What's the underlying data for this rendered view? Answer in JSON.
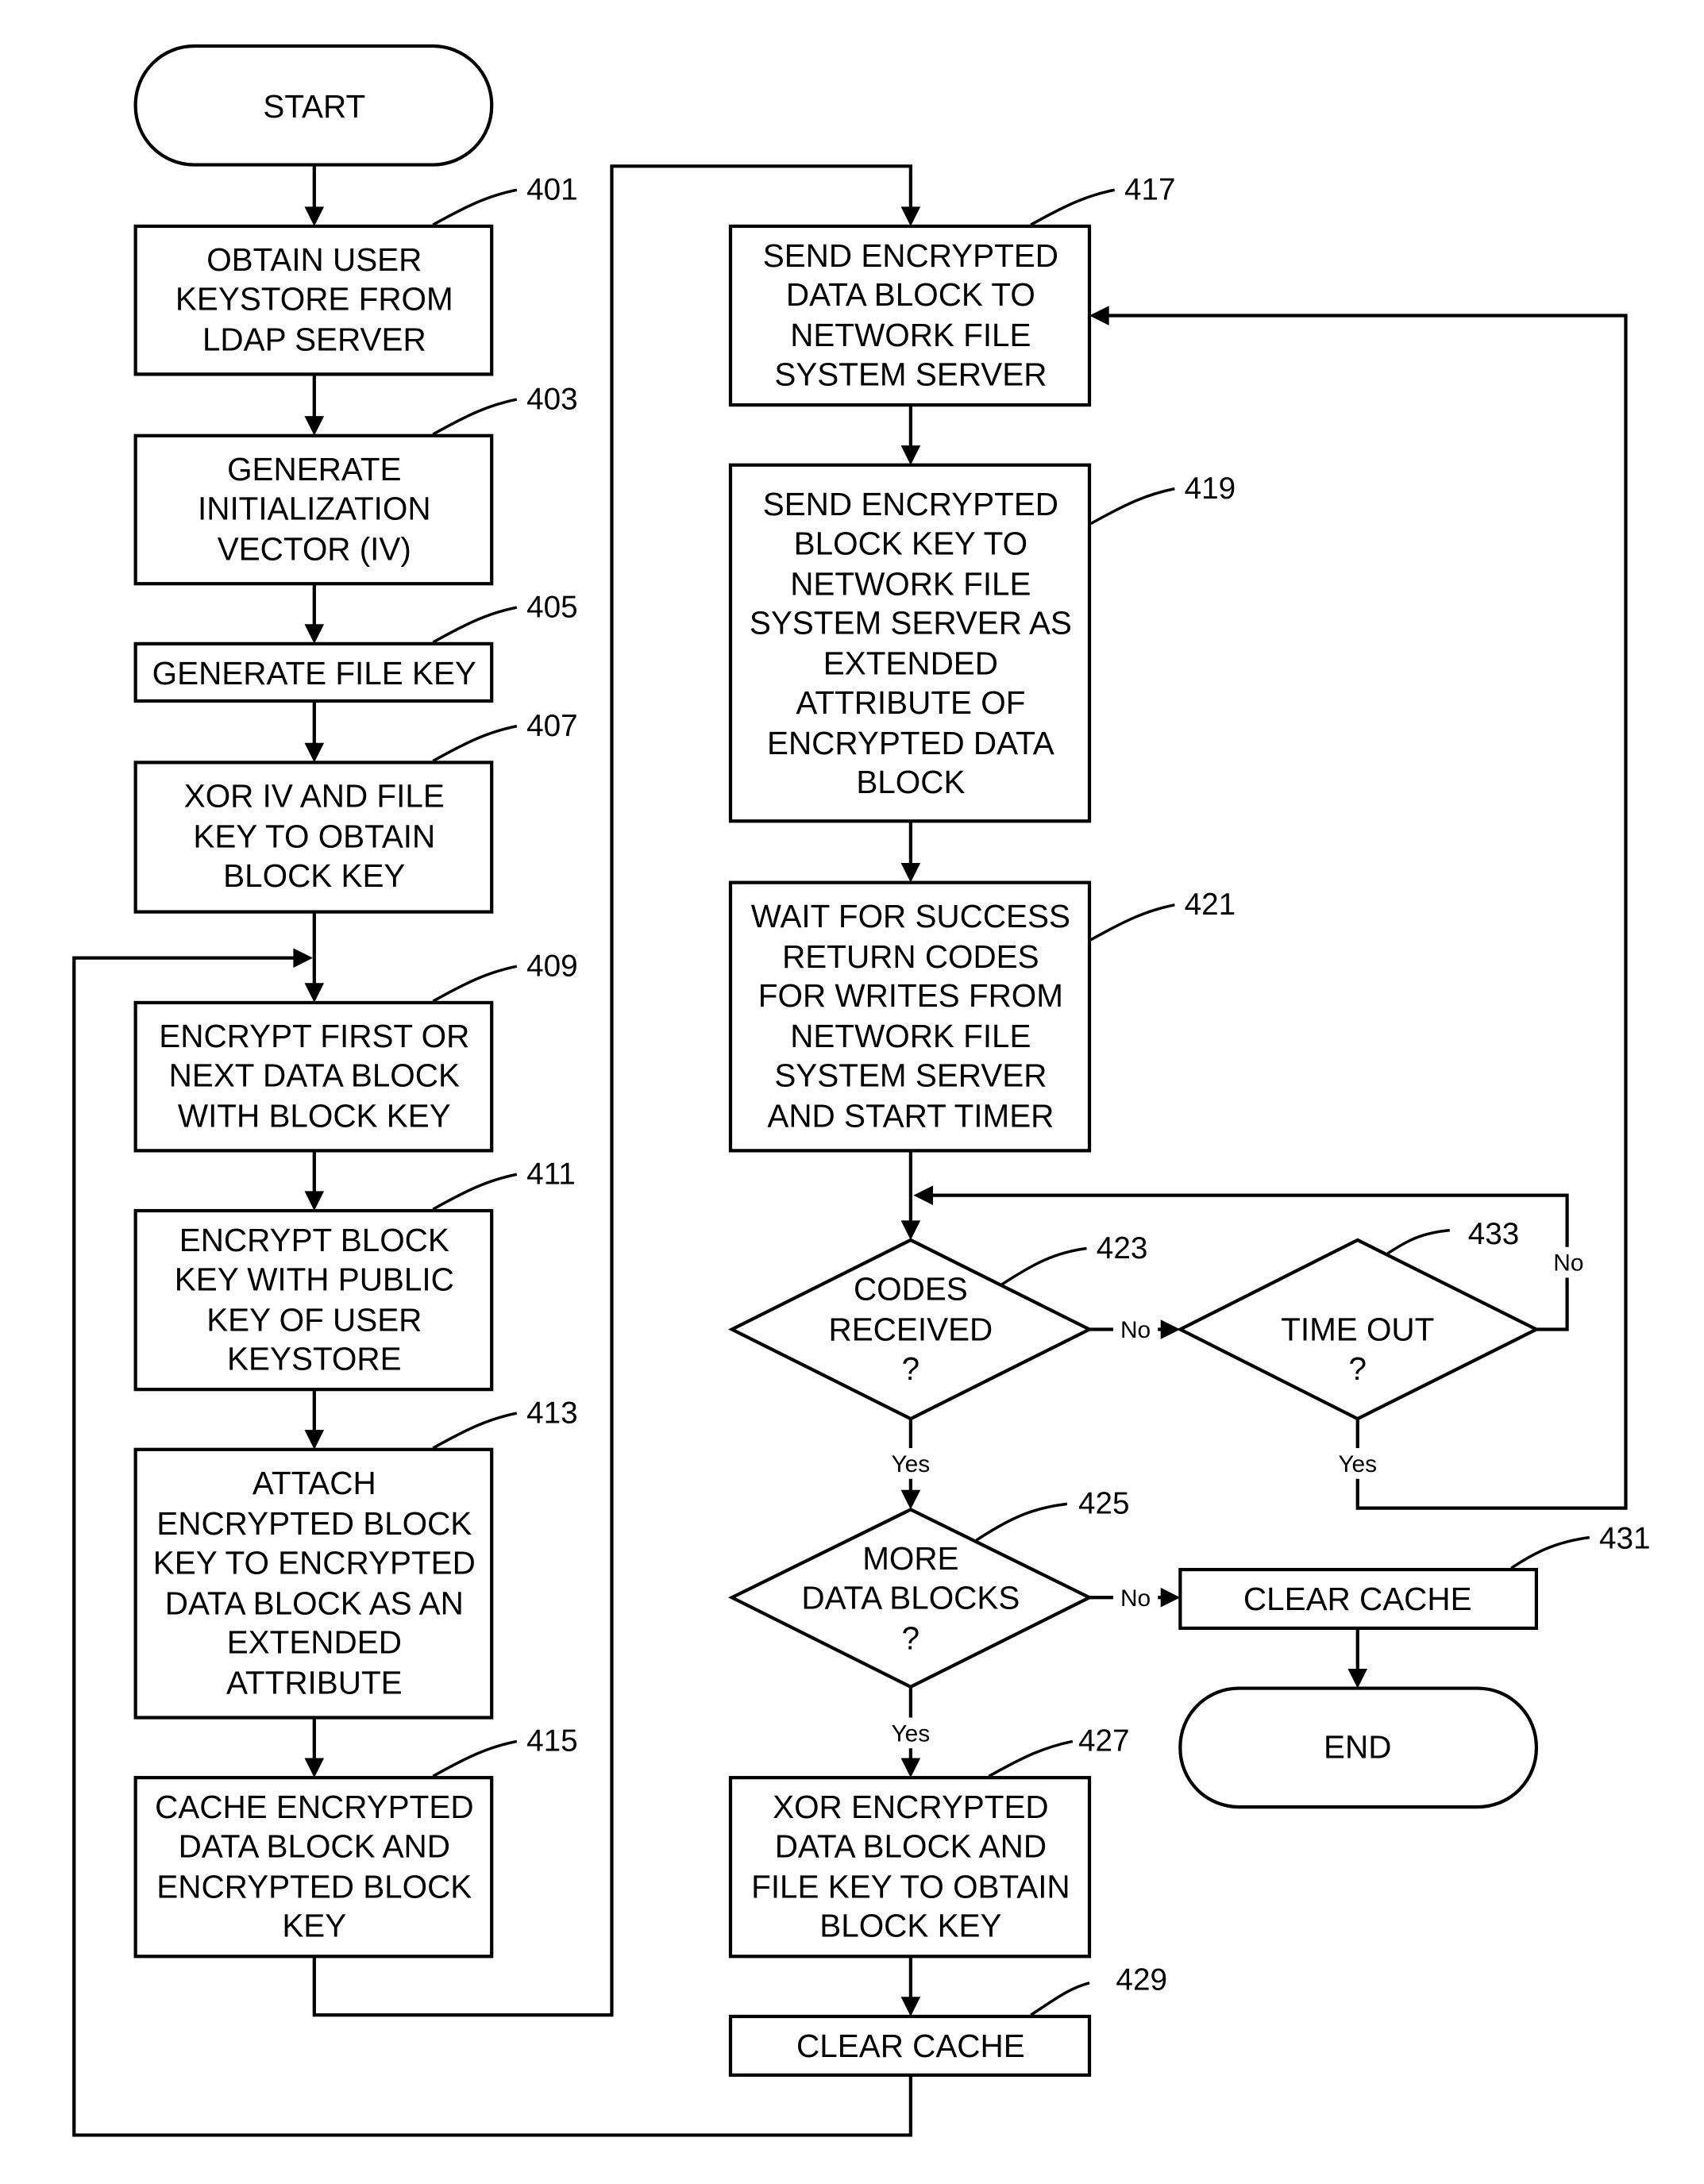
{
  "figure": {
    "terminals": {
      "start": "START",
      "end": "END"
    },
    "steps": [
      {
        "ref": "401",
        "lines": [
          "OBTAIN USER",
          "KEYSTORE FROM",
          "LDAP SERVER"
        ]
      },
      {
        "ref": "403",
        "lines": [
          "GENERATE",
          "INITIALIZATION",
          "VECTOR (IV)"
        ]
      },
      {
        "ref": "405",
        "lines": [
          "GENERATE FILE KEY"
        ]
      },
      {
        "ref": "407",
        "lines": [
          "XOR IV AND FILE",
          "KEY TO OBTAIN",
          "BLOCK KEY"
        ]
      },
      {
        "ref": "409",
        "lines": [
          "ENCRYPT FIRST OR",
          "NEXT DATA BLOCK",
          "WITH BLOCK KEY"
        ]
      },
      {
        "ref": "411",
        "lines": [
          "ENCRYPT BLOCK",
          "KEY WITH PUBLIC",
          "KEY OF USER",
          "KEYSTORE"
        ]
      },
      {
        "ref": "413",
        "lines": [
          "ATTACH",
          "ENCRYPTED BLOCK",
          "KEY TO ENCRYPTED",
          "DATA BLOCK AS AN",
          "EXTENDED",
          "ATTRIBUTE"
        ]
      },
      {
        "ref": "415",
        "lines": [
          "CACHE ENCRYPTED",
          "DATA BLOCK AND",
          "ENCRYPTED BLOCK",
          "KEY"
        ]
      },
      {
        "ref": "417",
        "lines": [
          "SEND ENCRYPTED",
          "DATA BLOCK TO",
          "NETWORK FILE",
          "SYSTEM SERVER"
        ]
      },
      {
        "ref": "419",
        "lines": [
          "SEND ENCRYPTED",
          "BLOCK KEY TO",
          "NETWORK FILE",
          "SYSTEM SERVER AS",
          "EXTENDED",
          "ATTRIBUTE OF",
          "ENCRYPTED DATA",
          "BLOCK"
        ]
      },
      {
        "ref": "421",
        "lines": [
          "WAIT FOR SUCCESS",
          "RETURN CODES",
          "FOR WRITES FROM",
          "NETWORK FILE",
          "SYSTEM SERVER",
          "AND START TIMER"
        ]
      },
      {
        "ref": "427",
        "lines": [
          "XOR ENCRYPTED",
          "DATA BLOCK AND",
          "FILE KEY TO OBTAIN",
          "BLOCK KEY"
        ]
      },
      {
        "ref": "429",
        "lines": [
          "CLEAR CACHE"
        ]
      },
      {
        "ref": "431",
        "lines": [
          "CLEAR CACHE"
        ]
      }
    ],
    "decisions": [
      {
        "ref": "423",
        "lines": [
          "CODES",
          "RECEIVED",
          "?"
        ]
      },
      {
        "ref": "433",
        "lines": [
          "TIME OUT",
          "?"
        ]
      },
      {
        "ref": "425",
        "lines": [
          "MORE",
          "DATA BLOCKS",
          "?"
        ]
      }
    ],
    "branch_labels": {
      "yes": "Yes",
      "no": "No"
    }
  }
}
